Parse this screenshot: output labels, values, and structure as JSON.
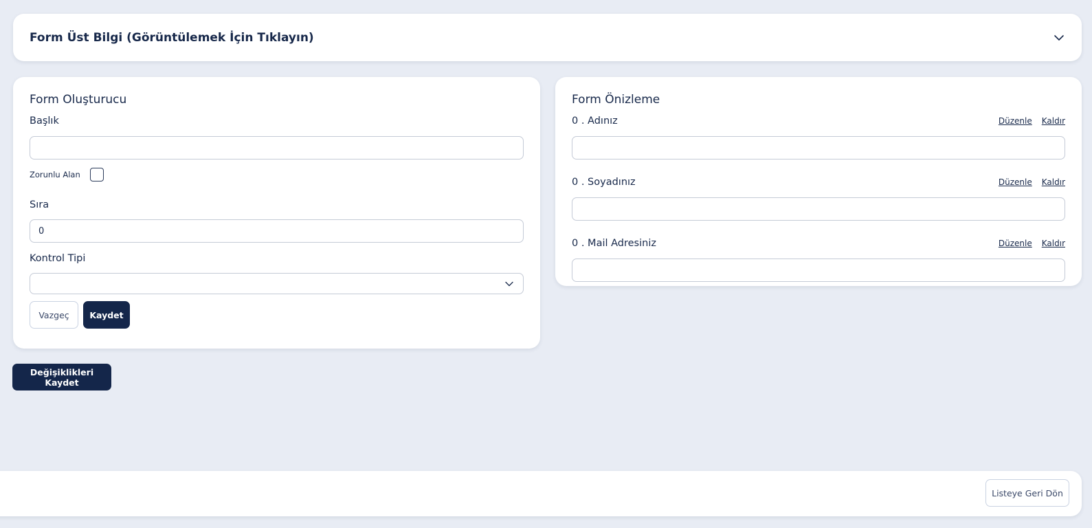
{
  "header": {
    "accordion_title": "Form Üst Bilgi (Görüntülemek İçin Tıklayın)",
    "accordion_icon": "chevron-down-icon"
  },
  "builder": {
    "title": "Form Oluşturucu",
    "title_label": "Başlık",
    "title_value": "",
    "required_label": "Zorunlu Alan",
    "required_checked": false,
    "order_label": "Sıra",
    "order_value": "0",
    "control_type_label": "Kontrol Tipi",
    "control_type_value": "",
    "cancel_label": "Vazgeç",
    "save_label": "Kaydet"
  },
  "preview": {
    "title": "Form Önizleme",
    "edit_label": "Düzenle",
    "remove_label": "Kaldır",
    "fields": [
      {
        "label": "0 . Adınız",
        "value": ""
      },
      {
        "label": "0 . Soyadınız",
        "value": ""
      },
      {
        "label": "0 . Mail Adresiniz",
        "value": ""
      }
    ]
  },
  "save_changes_label": "Değişiklikleri Kaydet",
  "footer": {
    "back_label": "Listeye Geri Dön"
  },
  "colors": {
    "background": "#e8ecf4",
    "primary": "#14264a",
    "card": "#ffffff"
  }
}
